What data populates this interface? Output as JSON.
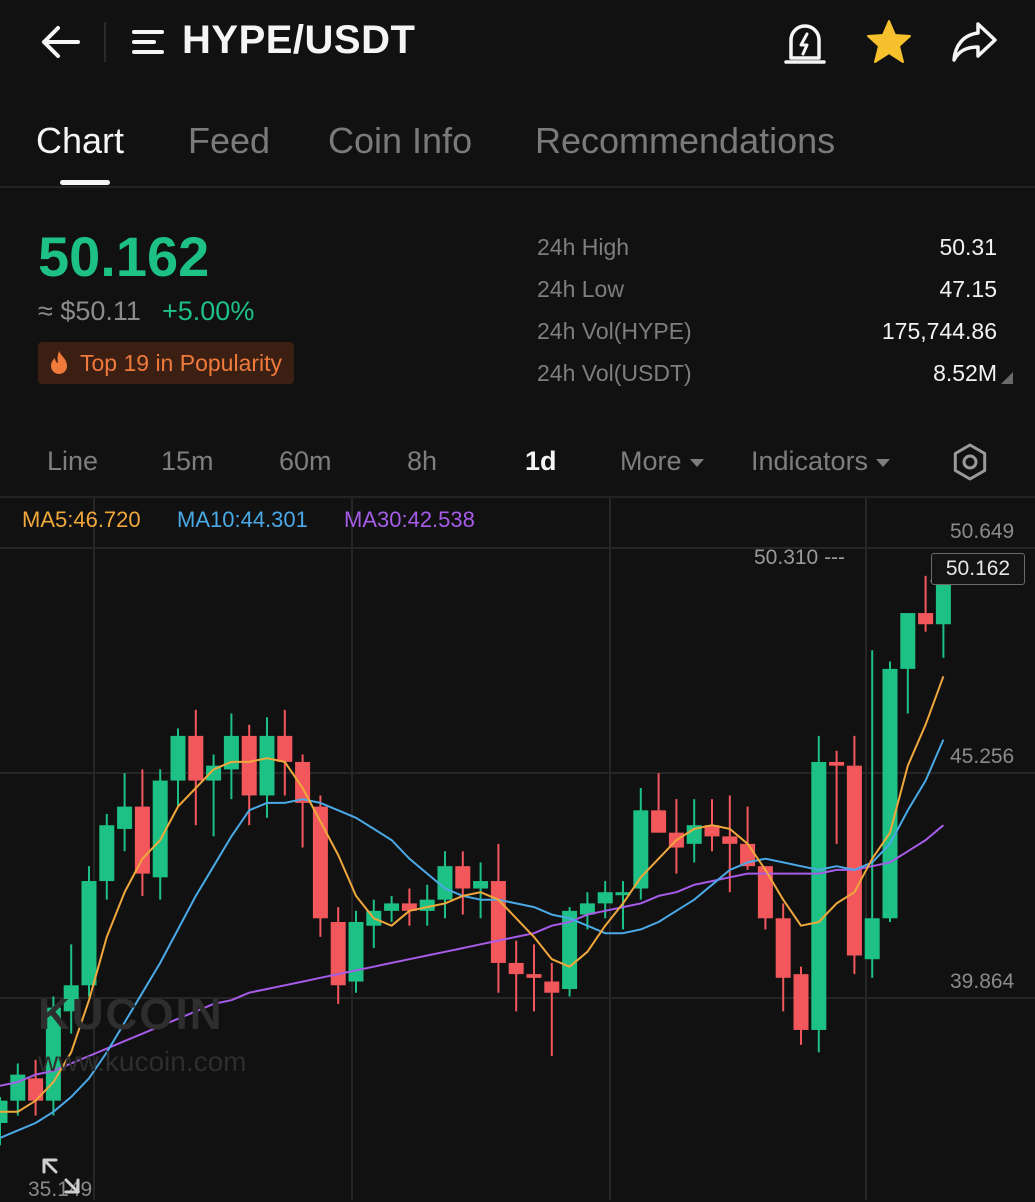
{
  "header": {
    "pair": "HYPE/USDT",
    "icons": [
      "back-arrow-icon",
      "menu-lines-icon",
      "price-alert-icon",
      "star-icon",
      "share-icon"
    ],
    "star_color": "#f6c12c"
  },
  "tabs": [
    {
      "label": "Chart",
      "active": true
    },
    {
      "label": "Feed",
      "active": false
    },
    {
      "label": "Coin Info",
      "active": false
    },
    {
      "label": "Recommendations",
      "active": false
    }
  ],
  "ticker": {
    "price": "50.162",
    "usd_price": "≈ $50.11",
    "change": "+5.00%",
    "badge": "Top 19 in Popularity",
    "up_color": "#1dc186",
    "down_color": "#f2575c"
  },
  "stats": [
    {
      "label": "24h High",
      "value": "50.31"
    },
    {
      "label": "24h Low",
      "value": "47.15"
    },
    {
      "label": "24h Vol(HYPE)",
      "value": "175,744.86"
    },
    {
      "label": "24h Vol(USDT)",
      "value": "8.52M"
    }
  ],
  "timeframes": {
    "line": "Line",
    "m15": "15m",
    "m60": "60m",
    "h8": "8h",
    "d1": "1d",
    "more": "More",
    "indicators": "Indicators",
    "active": "1d"
  },
  "ma_legend": {
    "ma5": "MA5:46.720",
    "ma10": "MA10:44.301",
    "ma30": "MA30:42.538",
    "ma5_color": "#f0a73c",
    "ma10_color": "#4aa9e6",
    "ma30_color": "#a65ce8"
  },
  "axis": {
    "labels": [
      "50.649",
      "45.256",
      "39.864"
    ],
    "bottom": "35.149",
    "high_marker": "50.310 ---",
    "current": "50.162"
  },
  "watermark": {
    "logo": "KUCOIN",
    "url": "www.kucoin.com"
  },
  "chart_data": {
    "type": "candlestick",
    "ylim": [
      33.8,
      51.8
    ],
    "candles": [
      [
        35.6,
        36.3,
        35.0,
        36.2
      ],
      [
        36.2,
        37.2,
        35.8,
        36.9
      ],
      [
        36.8,
        37.3,
        35.8,
        36.2
      ],
      [
        36.2,
        39.0,
        35.8,
        38.7
      ],
      [
        38.6,
        40.4,
        38.0,
        39.3
      ],
      [
        39.3,
        42.5,
        39.0,
        42.1
      ],
      [
        42.1,
        43.9,
        41.6,
        43.6
      ],
      [
        43.5,
        45.0,
        42.9,
        44.1
      ],
      [
        44.1,
        45.1,
        41.7,
        42.3
      ],
      [
        42.2,
        45.1,
        41.6,
        44.8
      ],
      [
        44.8,
        46.2,
        44.1,
        46.0
      ],
      [
        46.0,
        46.7,
        43.6,
        44.8
      ],
      [
        44.8,
        45.5,
        43.3,
        45.2
      ],
      [
        45.1,
        46.6,
        44.3,
        46.0
      ],
      [
        46.0,
        46.3,
        43.6,
        44.4
      ],
      [
        44.4,
        46.5,
        43.8,
        46.0
      ],
      [
        46.0,
        46.7,
        44.4,
        45.3
      ],
      [
        45.3,
        45.5,
        43.0,
        44.2
      ],
      [
        44.1,
        44.4,
        40.6,
        41.1
      ],
      [
        41.0,
        41.4,
        38.8,
        39.3
      ],
      [
        39.4,
        41.3,
        39.1,
        41.0
      ],
      [
        40.9,
        41.6,
        40.3,
        41.3
      ],
      [
        41.3,
        41.7,
        41.0,
        41.5
      ],
      [
        41.5,
        41.9,
        40.9,
        41.3
      ],
      [
        41.3,
        42.0,
        40.9,
        41.6
      ],
      [
        41.6,
        42.9,
        41.1,
        42.5
      ],
      [
        42.5,
        42.9,
        41.2,
        41.9
      ],
      [
        41.9,
        42.6,
        41.1,
        42.1
      ],
      [
        42.1,
        43.1,
        39.1,
        39.9
      ],
      [
        39.9,
        40.5,
        38.6,
        39.6
      ],
      [
        39.6,
        40.4,
        38.6,
        39.5
      ],
      [
        39.4,
        39.9,
        37.4,
        39.1
      ],
      [
        39.2,
        41.4,
        39.0,
        41.3
      ],
      [
        41.2,
        41.8,
        40.8,
        41.5
      ],
      [
        41.5,
        42.1,
        41.1,
        41.8
      ],
      [
        41.8,
        42.1,
        40.8,
        41.8
      ],
      [
        41.9,
        44.6,
        41.6,
        44.0
      ],
      [
        44.0,
        45.0,
        43.4,
        43.4
      ],
      [
        43.4,
        44.3,
        42.3,
        43.0
      ],
      [
        43.1,
        44.3,
        42.6,
        43.6
      ],
      [
        43.6,
        44.3,
        42.9,
        43.3
      ],
      [
        43.3,
        44.4,
        41.8,
        43.1
      ],
      [
        43.1,
        44.1,
        42.4,
        42.5
      ],
      [
        42.5,
        42.5,
        40.8,
        41.1
      ],
      [
        41.1,
        41.5,
        38.6,
        39.5
      ],
      [
        39.6,
        39.8,
        37.7,
        38.1
      ],
      [
        38.1,
        46.0,
        37.5,
        45.3
      ],
      [
        45.3,
        45.6,
        43.1,
        45.2
      ],
      [
        45.2,
        46.0,
        39.6,
        40.1
      ],
      [
        40.0,
        48.3,
        39.5,
        41.1
      ],
      [
        41.1,
        48.0,
        41.0,
        47.8
      ],
      [
        47.8,
        48.9,
        46.6,
        49.3
      ],
      [
        49.3,
        50.3,
        48.8,
        49.0
      ],
      [
        49.0,
        50.31,
        48.1,
        50.162
      ]
    ],
    "ma5": [
      35.9,
      35.9,
      36.2,
      36.7,
      37.5,
      38.9,
      40.6,
      41.8,
      42.7,
      43.2,
      44.1,
      44.6,
      45.1,
      45.3,
      45.3,
      45.4,
      45.3,
      44.6,
      43.7,
      42.8,
      41.7,
      41.1,
      40.9,
      41.3,
      41.4,
      41.5,
      41.7,
      41.8,
      41.6,
      41.1,
      40.6,
      40.0,
      39.8,
      40.2,
      40.9,
      41.5,
      42.2,
      42.7,
      43.2,
      43.5,
      43.6,
      43.5,
      43.1,
      42.4,
      41.6,
      40.9,
      41.0,
      41.5,
      41.8,
      42.7,
      43.4,
      45.2,
      46.3,
      47.6
    ],
    "ma10": [
      35.2,
      35.4,
      35.6,
      35.9,
      36.3,
      36.8,
      37.5,
      38.3,
      39.1,
      39.9,
      40.8,
      41.7,
      42.5,
      43.3,
      44.0,
      44.2,
      44.2,
      44.3,
      44.2,
      44.0,
      43.8,
      43.5,
      43.2,
      42.7,
      42.3,
      41.9,
      41.7,
      41.6,
      41.6,
      41.5,
      41.4,
      41.2,
      41.1,
      40.9,
      40.7,
      40.7,
      40.8,
      41.0,
      41.3,
      41.6,
      42.0,
      42.4,
      42.6,
      42.7,
      42.6,
      42.5,
      42.4,
      42.5,
      42.4,
      42.6,
      43.1,
      44.0,
      44.8,
      45.9
    ],
    "ma30": [
      36.6,
      36.7,
      36.9,
      37.0,
      37.2,
      37.4,
      37.6,
      37.8,
      38.0,
      38.2,
      38.4,
      38.6,
      38.8,
      38.9,
      39.1,
      39.2,
      39.3,
      39.4,
      39.5,
      39.6,
      39.7,
      39.8,
      39.9,
      40.0,
      40.1,
      40.2,
      40.3,
      40.4,
      40.5,
      40.6,
      40.7,
      40.9,
      41.0,
      41.2,
      41.3,
      41.4,
      41.5,
      41.7,
      41.8,
      42.0,
      42.1,
      42.2,
      42.3,
      42.3,
      42.3,
      42.3,
      42.3,
      42.4,
      42.4,
      42.5,
      42.6,
      42.9,
      43.2,
      43.6
    ]
  }
}
